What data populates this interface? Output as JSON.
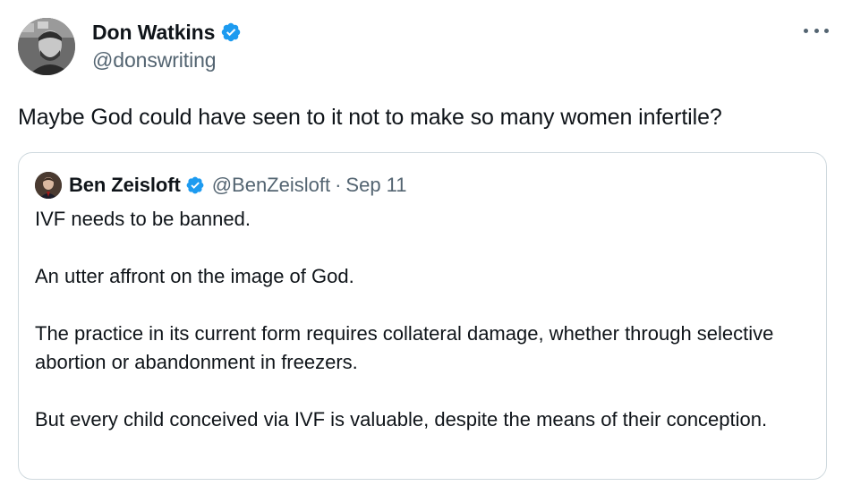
{
  "tweet": {
    "author": {
      "name": "Don Watkins",
      "handle": "@donswriting"
    },
    "text": "Maybe God could have seen to it not to make so many women infertile?",
    "quoted": {
      "author": {
        "name": "Ben Zeisloft",
        "handle": "@BenZeisloft",
        "separator": "·",
        "date": "Sep 11"
      },
      "paragraphs": [
        "IVF needs to be banned.",
        "An utter affront on the image of God.",
        "The practice in its current form requires collateral damage, whether through selective abortion or abandonment in freezers.",
        "But every child conceived via IVF is valuable, despite the means of their conception."
      ]
    }
  },
  "icons": {
    "verified": "verified-badge-icon",
    "more": "more-options-icon"
  },
  "colors": {
    "verified": "#1d9bf0",
    "text": "#0f1419",
    "secondary": "#536471",
    "border": "#cfd9de"
  }
}
